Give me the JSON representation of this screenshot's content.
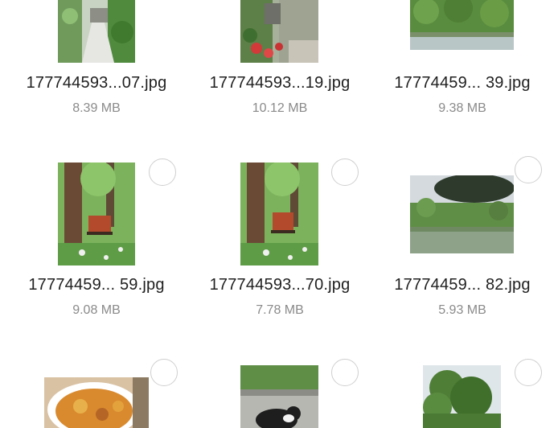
{
  "files": [
    {
      "name": "177744593...07.jpg",
      "size": "8.39 MB",
      "thumb": "garden-path"
    },
    {
      "name": "177744593...19.jpg",
      "size": "10.12 MB",
      "thumb": "flower-stairs"
    },
    {
      "name": "17774459... 39.jpg",
      "size": "9.38 MB",
      "thumb": "lake-shore"
    },
    {
      "name": "17774459... 59.jpg",
      "size": "9.08 MB",
      "thumb": "bench-trees"
    },
    {
      "name": "177744593...70.jpg",
      "size": "7.78 MB",
      "thumb": "bench-trees"
    },
    {
      "name": "17774459... 82.jpg",
      "size": "5.93 MB",
      "thumb": "lake-tree"
    },
    {
      "name": "",
      "size": "",
      "thumb": "food-plate"
    },
    {
      "name": "",
      "size": "",
      "thumb": "cat-street"
    },
    {
      "name": "",
      "size": "",
      "thumb": "tree-sky"
    }
  ],
  "colors": {
    "filename": "#1f1f1f",
    "filesize": "#8a8a8a",
    "checkbox_border": "#cfcfcf"
  }
}
